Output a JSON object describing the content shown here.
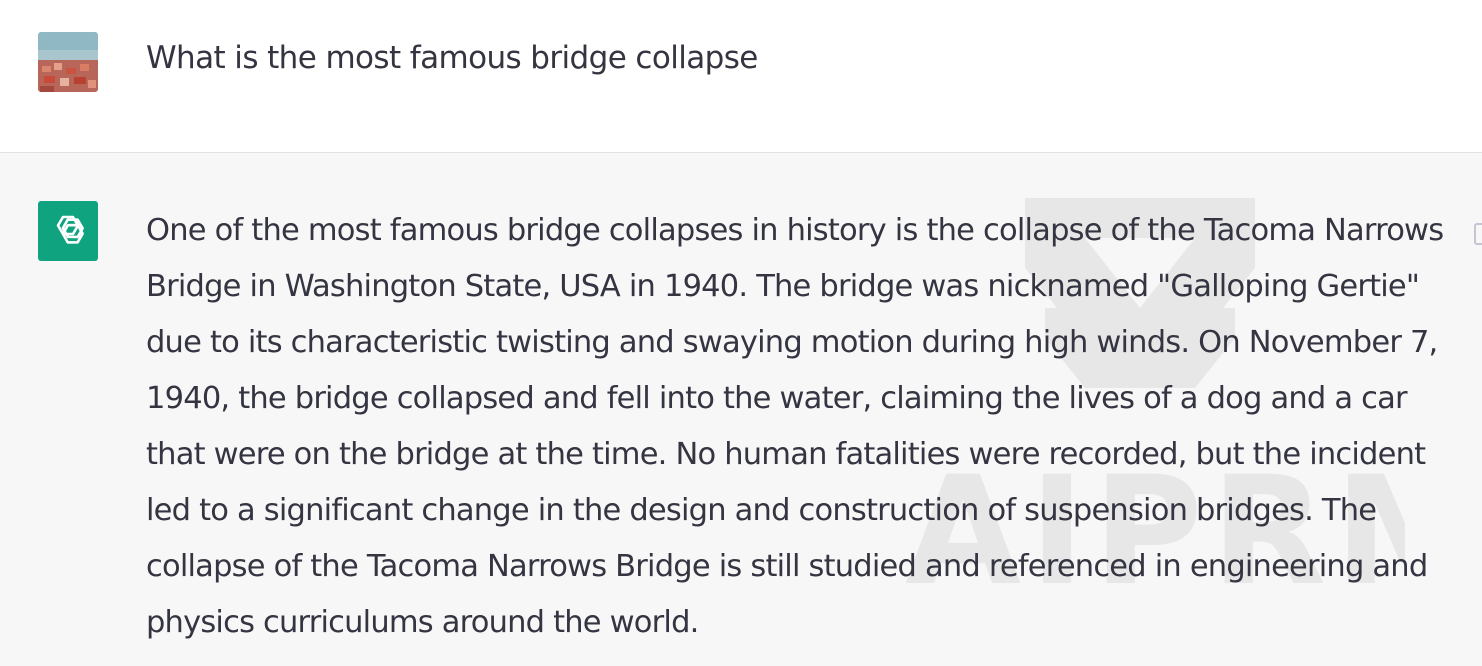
{
  "conversation": {
    "user": {
      "avatar_icon": "user-photo-avatar",
      "message": "What is the most famous bridge collapse"
    },
    "assistant": {
      "avatar_icon": "openai-logo-icon",
      "avatar_color": "#10a37f",
      "message": "One of the most famous bridge collapses in history is the collapse of the Tacoma Narrows Bridge in Washington State, USA in 1940. The bridge was nicknamed \"Galloping Gertie\" due to its characteristic twisting and swaying motion during high winds. On November 7, 1940, the bridge collapsed and fell into the water, claiming the lives of a dog and a car that were on the bridge at the time. No human fatalities were recorded, but the incident led to a significant change in the design and construction of suspension bridges. The collapse of the Tacoma Narrows Bridge is still studied and referenced in engineering and physics curriculums around the world."
    }
  },
  "watermark": {
    "text": "AIPRM"
  }
}
